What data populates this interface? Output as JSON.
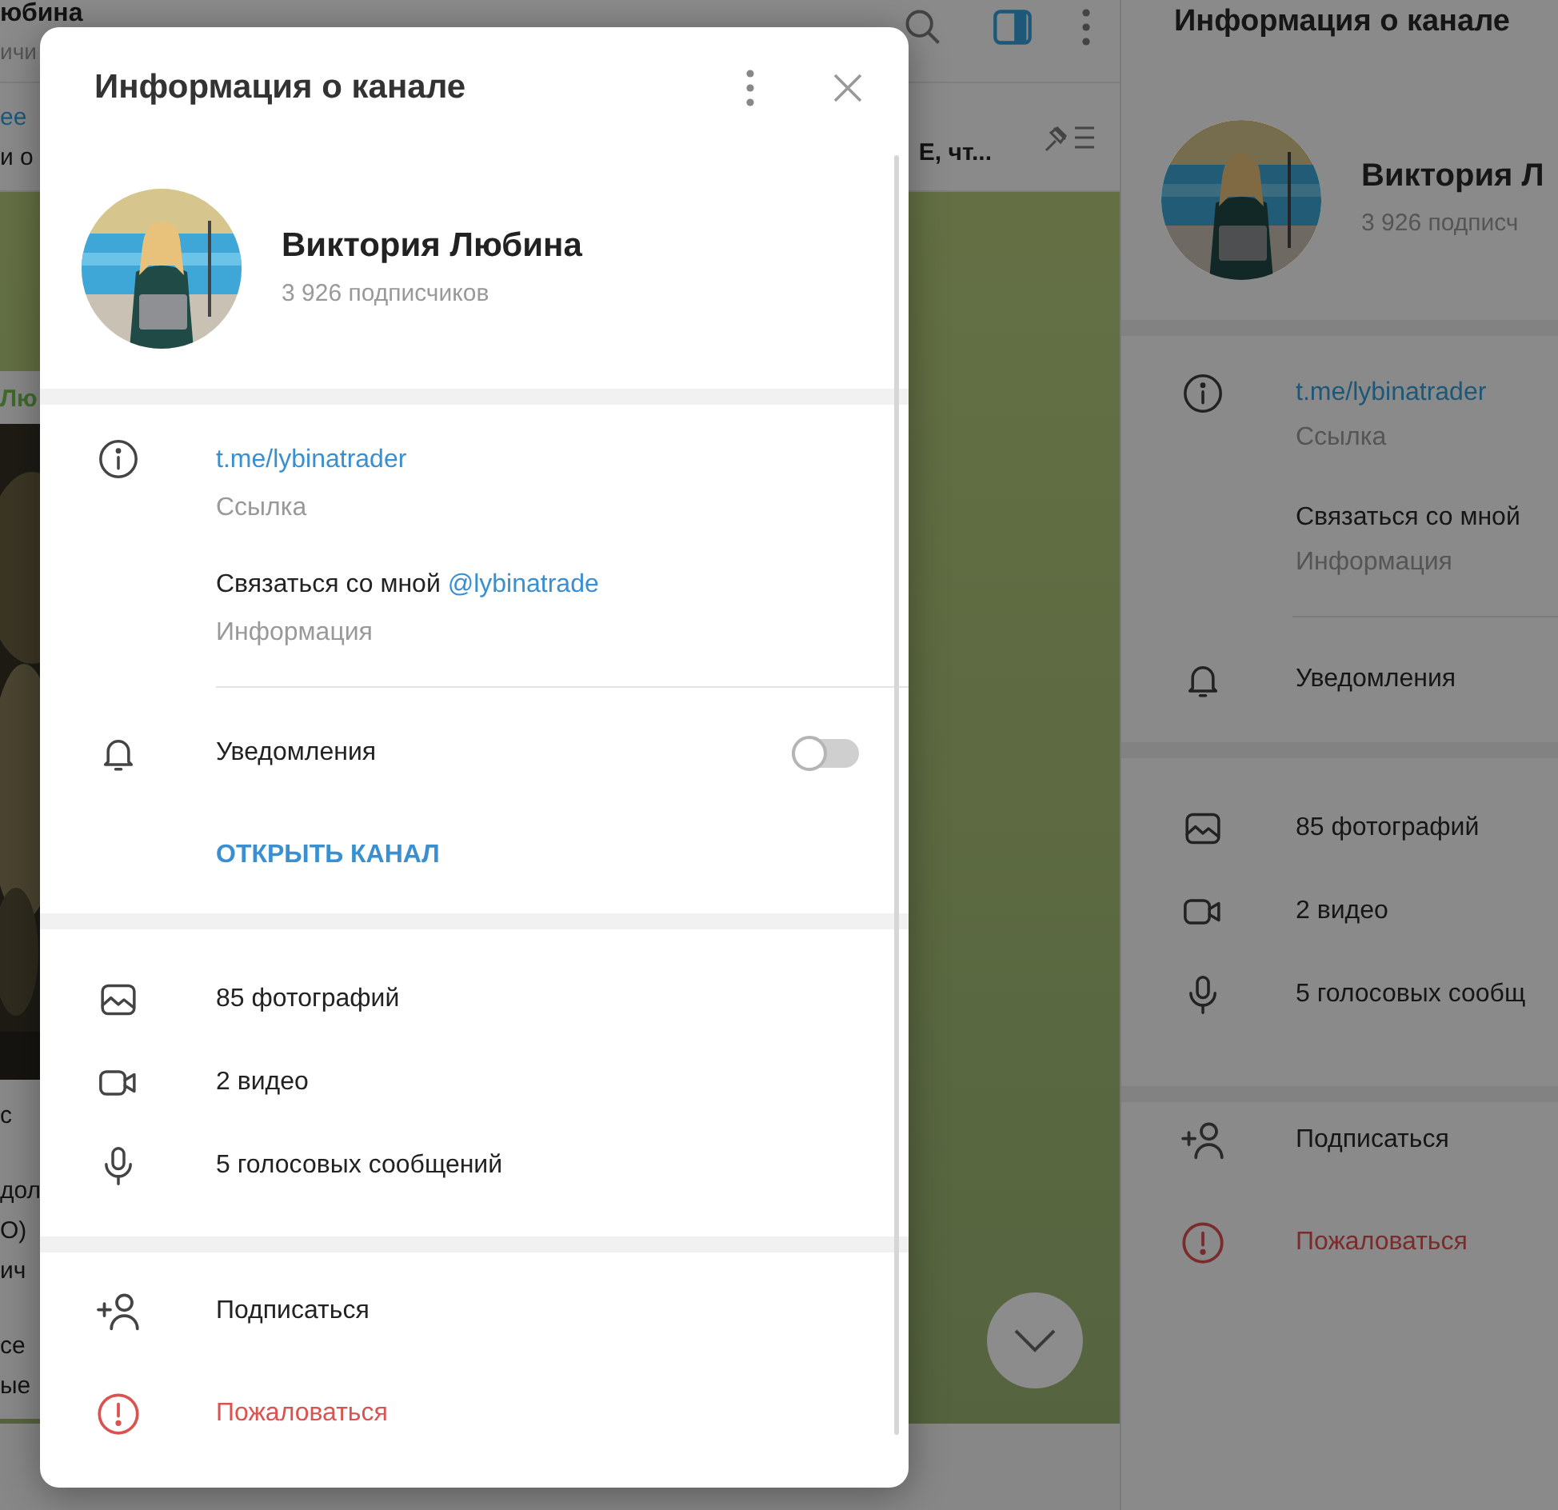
{
  "background": {
    "chat_header": {
      "title": "юбина",
      "subtitle": "ичи"
    },
    "pinned": {
      "line_1": "ее",
      "line_2": "и о",
      "preview": "Е, чт..."
    },
    "message": {
      "author": "Лю",
      "lines": [
        "с",
        "дол",
        "О)",
        "ич",
        "се",
        "ые"
      ]
    },
    "side_panel": {
      "title": "Информация о канале",
      "name": "Виктория Л",
      "subscribers": "3 926 подписч",
      "link": "t.me/lybinatrader",
      "link_label": "Ссылка",
      "about": "Связаться со мной",
      "about_label": "Информация",
      "notifications": "Уведомления",
      "media": [
        {
          "label": "85 фотографий"
        },
        {
          "kind": "video",
          "label": "2 видео"
        },
        {
          "kind": "voice",
          "label": "5 голосовых сообщ"
        }
      ],
      "actions": [
        {
          "kind": "subscribe",
          "label": "Подписаться"
        },
        {
          "kind": "report",
          "label": "Пожаловаться"
        }
      ]
    }
  },
  "dialog": {
    "title": "Информация о канале",
    "name": "Виктория Любина",
    "subscribers": "3 926 подписчиков",
    "link": "t.me/lybinatrader",
    "link_label": "Ссылка",
    "about_text": "Связаться со мной",
    "about_mention": "@lybinatrade",
    "about_label": "Информация",
    "notifications": {
      "label": "Уведомления",
      "on": false
    },
    "open_channel": "ОТКРЫТЬ КАНАЛ",
    "media": [
      {
        "label": "85 фотографий"
      },
      {
        "kind": "video",
        "label": "2 видео"
      },
      {
        "kind": "voice",
        "label": "5 голосовых сообщений"
      }
    ],
    "actions": [
      {
        "kind": "subscribe",
        "label": "Подписаться"
      },
      {
        "kind": "report",
        "label": "Пожаловаться"
      }
    ]
  }
}
